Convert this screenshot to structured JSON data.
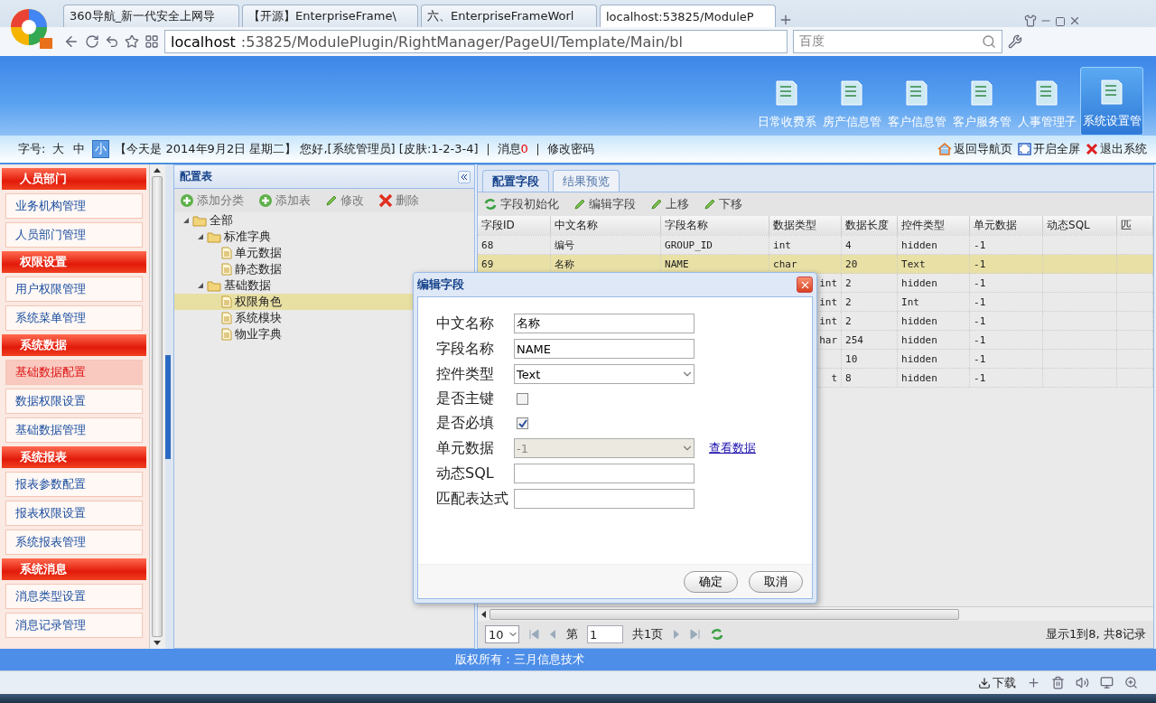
{
  "browser": {
    "tabs": [
      {
        "label": "360导航_新一代安全上网导",
        "selected": false
      },
      {
        "label": "【开源】EnterpriseFrame\\",
        "selected": false
      },
      {
        "label": "六、EnterpriseFrameWorl",
        "selected": false
      },
      {
        "label": "localhost:53825/ModuleP",
        "selected": true
      }
    ],
    "address": {
      "host": "localhost",
      "path": ":53825/ModulePlugin/RightManager/PageUI/Template/Main/bl"
    },
    "search": {
      "placeholder": "百度"
    }
  },
  "header": {
    "modules": [
      {
        "label": "日常收费系",
        "selected": false
      },
      {
        "label": "房产信息管",
        "selected": false
      },
      {
        "label": "客户信息管",
        "selected": false
      },
      {
        "label": "客户服务管",
        "selected": false
      },
      {
        "label": "人事管理子",
        "selected": false
      },
      {
        "label": "系统设置管",
        "selected": true
      }
    ]
  },
  "infobar": {
    "font_label": "字号:",
    "font_sizes": [
      {
        "label": "大",
        "selected": false
      },
      {
        "label": "中",
        "selected": false
      },
      {
        "label": "小",
        "selected": true
      }
    ],
    "greeting": "【今天是 2014年9月2日 星期二】 您好,[系统管理员] [皮肤:1-2-3-4]",
    "message_label": "消息",
    "message_count": "0",
    "change_password": "修改密码",
    "actions": [
      {
        "kind": "home",
        "label": "返回导航页"
      },
      {
        "kind": "fullscreen",
        "label": "开启全屏"
      },
      {
        "kind": "exit",
        "label": "退出系统"
      }
    ]
  },
  "sidebar": {
    "groups": [
      {
        "title": "人员部门",
        "items": [
          {
            "label": "业务机构管理",
            "selected": false
          },
          {
            "label": "人员部门管理",
            "selected": false
          }
        ]
      },
      {
        "title": "权限设置",
        "items": [
          {
            "label": "用户权限管理",
            "selected": false
          },
          {
            "label": "系统菜单管理",
            "selected": false
          }
        ]
      },
      {
        "title": "系统数据",
        "items": [
          {
            "label": "基础数据配置",
            "selected": true
          },
          {
            "label": "数据权限设置",
            "selected": false
          },
          {
            "label": "基础数据管理",
            "selected": false
          }
        ]
      },
      {
        "title": "系统报表",
        "items": [
          {
            "label": "报表参数配置",
            "selected": false
          },
          {
            "label": "报表权限设置",
            "selected": false
          },
          {
            "label": "系统报表管理",
            "selected": false
          }
        ]
      },
      {
        "title": "系统消息",
        "items": [
          {
            "label": "消息类型设置",
            "selected": false
          },
          {
            "label": "消息记录管理",
            "selected": false
          }
        ]
      }
    ]
  },
  "tree_panel": {
    "title": "配置表",
    "toolbar": [
      {
        "kind": "add",
        "label": "添加分类"
      },
      {
        "kind": "add",
        "label": "添加表"
      },
      {
        "kind": "edit",
        "label": "修改"
      },
      {
        "kind": "delete",
        "label": "删除"
      }
    ],
    "tree": [
      {
        "label": "全部",
        "kind": "folder",
        "expanded": true,
        "selected": false,
        "children": [
          {
            "label": "标准字典",
            "kind": "folder",
            "expanded": true,
            "selected": false,
            "children": [
              {
                "label": "单元数据",
                "kind": "file",
                "selected": false
              },
              {
                "label": "静态数据",
                "kind": "file",
                "selected": false
              }
            ]
          },
          {
            "label": "基础数据",
            "kind": "folder",
            "expanded": true,
            "selected": false,
            "children": [
              {
                "label": "权限角色",
                "kind": "file",
                "selected": true
              },
              {
                "label": "系统模块",
                "kind": "file",
                "selected": false
              },
              {
                "label": "物业字典",
                "kind": "file",
                "selected": false
              }
            ]
          }
        ]
      }
    ]
  },
  "grid_panel": {
    "tabs": [
      {
        "label": "配置字段",
        "selected": true
      },
      {
        "label": "结果预览",
        "selected": false
      }
    ],
    "toolbar": [
      {
        "kind": "refresh",
        "label": "字段初始化"
      },
      {
        "kind": "edit",
        "label": "编辑字段"
      },
      {
        "kind": "edit",
        "label": "上移"
      },
      {
        "kind": "edit",
        "label": "下移"
      }
    ],
    "columns": [
      "字段ID",
      "中文名称",
      "字段名称",
      "数据类型",
      "数据长度",
      "控件类型",
      "单元数据",
      "动态SQL",
      "匹"
    ],
    "rows": [
      {
        "cells": [
          "68",
          "编号",
          "GROUP_ID",
          "int",
          "4",
          "hidden",
          "-1",
          null,
          null
        ],
        "selected": false,
        "covered": false
      },
      {
        "cells": [
          "69",
          "名称",
          "NAME",
          "char",
          "20",
          "Text",
          "-1",
          null,
          null
        ],
        "selected": true,
        "covered": false
      },
      {
        "cells": [
          null,
          null,
          null,
          "int",
          "2",
          "hidden",
          "-1",
          null,
          null
        ],
        "selected": false,
        "covered": true
      },
      {
        "cells": [
          null,
          null,
          null,
          "int",
          "2",
          "Int",
          "-1",
          null,
          null
        ],
        "selected": false,
        "covered": true
      },
      {
        "cells": [
          null,
          null,
          null,
          "int",
          "2",
          "hidden",
          "-1",
          null,
          null
        ],
        "selected": false,
        "covered": true
      },
      {
        "cells": [
          null,
          null,
          null,
          "har",
          "254",
          "hidden",
          "-1",
          null,
          null
        ],
        "selected": false,
        "covered": true
      },
      {
        "cells": [
          null,
          null,
          null,
          null,
          "10",
          "hidden",
          "-1",
          null,
          null
        ],
        "selected": false
      },
      {
        "cells": [
          null,
          null,
          null,
          "t",
          "8",
          "hidden",
          "-1",
          null,
          null
        ],
        "selected": false,
        "covered": true
      }
    ],
    "pager": {
      "page_size": "10",
      "page_label": "第",
      "page": "1",
      "total_pages": "共1页",
      "summary": "显示1到8, 共8记录"
    }
  },
  "dialog": {
    "title": "编辑字段",
    "fields": [
      {
        "kind": "text",
        "label": "中文名称",
        "value": "名称"
      },
      {
        "kind": "text",
        "label": "字段名称",
        "value": "NAME"
      },
      {
        "kind": "select",
        "label": "控件类型",
        "value": "Text",
        "disabled": false
      },
      {
        "kind": "checkbox",
        "label": "是否主键",
        "checked": false
      },
      {
        "kind": "checkbox",
        "label": "是否必填",
        "checked": true
      },
      {
        "kind": "select",
        "label": "单元数据",
        "value": "-1",
        "disabled": true,
        "link": "查看数据"
      },
      {
        "kind": "text",
        "label": "动态SQL"
      },
      {
        "kind": "text",
        "label": "匹配表达式"
      }
    ],
    "buttons": [
      "确定",
      "取消"
    ]
  },
  "footer": {
    "copyright": "版权所有：三月信息技术"
  },
  "status_bar": {
    "download": "下载"
  }
}
